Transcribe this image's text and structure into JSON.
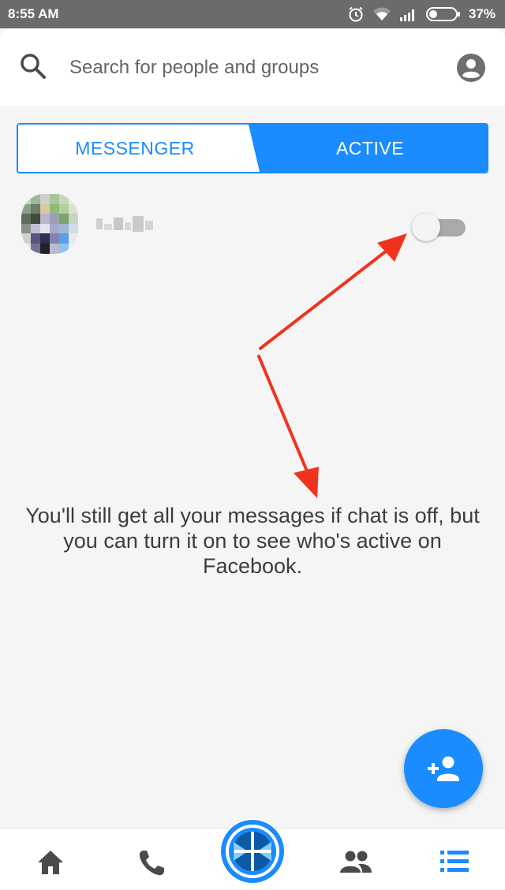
{
  "status_bar": {
    "time": "8:55 AM",
    "battery": "37%",
    "icons": [
      "alarm-icon",
      "wifi-icon",
      "signal-icon",
      "battery-icon"
    ]
  },
  "search": {
    "placeholder": "Search for people and groups",
    "icon": "search-icon",
    "profile_icon": "account-circle-icon"
  },
  "tabs": [
    {
      "label": "MESSENGER",
      "selected": false
    },
    {
      "label": "ACTIVE",
      "selected": true
    }
  ],
  "active_row": {
    "avatar": "pixelated-avatar",
    "toggle_on": false
  },
  "info_text": "You'll still get all your messages if chat is off, but you can turn it on to see who's active on Facebook.",
  "fab": {
    "icon": "add-person-icon"
  },
  "bottom_nav": [
    {
      "icon": "home-icon"
    },
    {
      "icon": "phone-icon"
    },
    {
      "icon": "camera-capture-icon"
    },
    {
      "icon": "groups-icon"
    },
    {
      "icon": "list-icon",
      "selected": true
    }
  ],
  "colors": {
    "accent": "#1a8cff",
    "annotation_arrow": "#f0331e",
    "background": "#f5f5f5",
    "status_bar": "#6b6b6b"
  }
}
